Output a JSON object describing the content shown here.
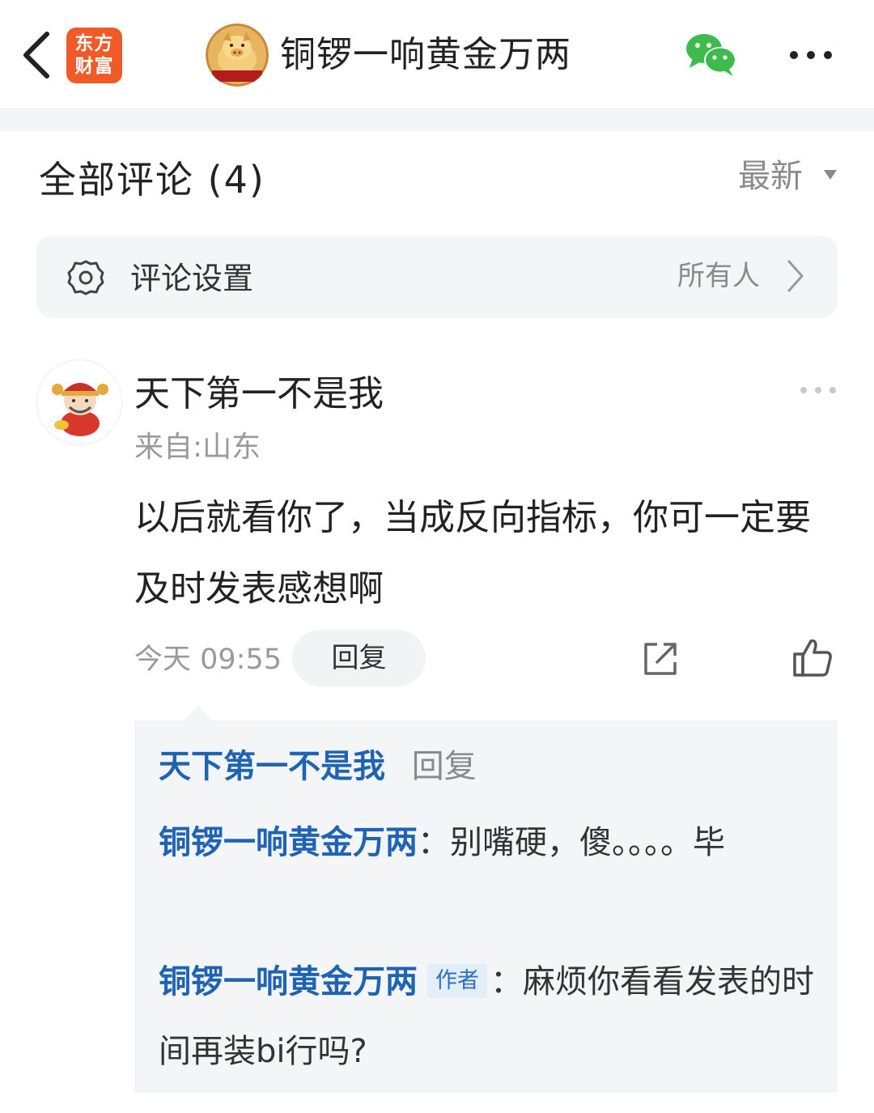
{
  "header": {
    "app_logo_line1": "东方",
    "app_logo_line2": "财富",
    "title": "铜锣一响黄金万两",
    "back_icon": "chevron-left-icon",
    "wechat_icon": "wechat-icon",
    "more_icon": "more-horizontal-icon"
  },
  "comments_section": {
    "title": "全部评论 (4)",
    "sort_label": "最新",
    "settings_label": "评论设置",
    "settings_value": "所有人"
  },
  "comment": {
    "author": "天下第一不是我",
    "location": "来自:山东",
    "text": "以后就看你了，当成反向指标，你可一定要及时发表感想啊",
    "time": "今天 09:55",
    "reply_button": "回复"
  },
  "replies": {
    "header_name": "天下第一不是我",
    "header_action": "回复",
    "items": [
      {
        "name": "铜锣一响黄金万两",
        "badge": "",
        "separator": "：",
        "text": "别嘴硬，傻。。。。毕"
      },
      {
        "name": "铜锣一响黄金万两",
        "badge": "作者",
        "separator": "：",
        "text": "麻烦你看看发表的时间再装bi行吗?"
      }
    ]
  },
  "colors": {
    "brand_orange": "#f05a28",
    "link_blue": "#1e63b4",
    "wechat_green": "#3dbb4d",
    "panel_gray": "#f4f5f7"
  }
}
